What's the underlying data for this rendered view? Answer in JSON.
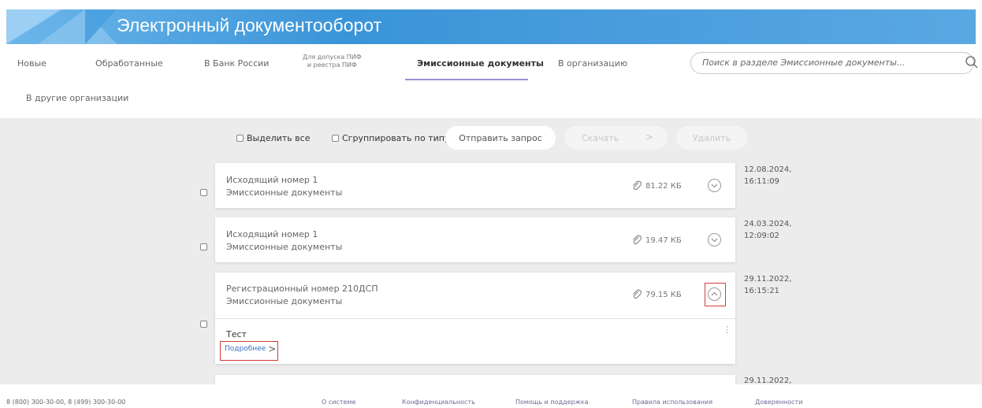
{
  "header": {
    "title": "Электронный документооборот"
  },
  "nav": {
    "tabs": [
      {
        "label": "Новые"
      },
      {
        "label": "Обработанные"
      },
      {
        "label": "В Банк России"
      },
      {
        "label_line1": "Для допуска ПИФ",
        "label_line2": "и реестра ПИФ"
      },
      {
        "label": "Эмиссионные документы",
        "active": true
      },
      {
        "label": "В организацию"
      },
      {
        "label": "В другие организации"
      }
    ],
    "search_placeholder": "Поиск в разделе Эмиссионные документы..."
  },
  "toolbar": {
    "select_all": "Выделить все",
    "group_by_type": "Сгруппировать по типу",
    "send_request": "Отправить запрос",
    "download": "Скачать",
    "delete": "Удалить"
  },
  "documents": [
    {
      "title": "Исходящий номер 1",
      "type": "Эмиссионные документы",
      "size": "81.22 КБ",
      "date": "12.08.2024,",
      "time": "16:11:09"
    },
    {
      "title": "Исходящий номер 1",
      "type": "Эмиссионные документы",
      "size": "19.47 КБ",
      "date": "24.03.2024,",
      "time": "12:09:02"
    },
    {
      "title": "Регистрационный номер 210ДСП",
      "type": "Эмиссионные документы",
      "size": "79.15 КБ",
      "date": "29.11.2022,",
      "time": "16:15:21",
      "expanded": true,
      "detail_text": "Тест",
      "detail_link": "Подробнее"
    },
    {
      "date": "29.11.2022,"
    }
  ],
  "footer": {
    "phones": "8 (800) 300-30-00, 8 (499) 300-30-00",
    "links": [
      "О системе",
      "Конфиденциальность",
      "Помощь и поддержка",
      "Правила использования",
      "Доверенности"
    ]
  },
  "colors": {
    "header": "#3a94d8",
    "active_underline": "#9b8fd4",
    "highlight": "#d23c3c",
    "background": "#ececec"
  }
}
